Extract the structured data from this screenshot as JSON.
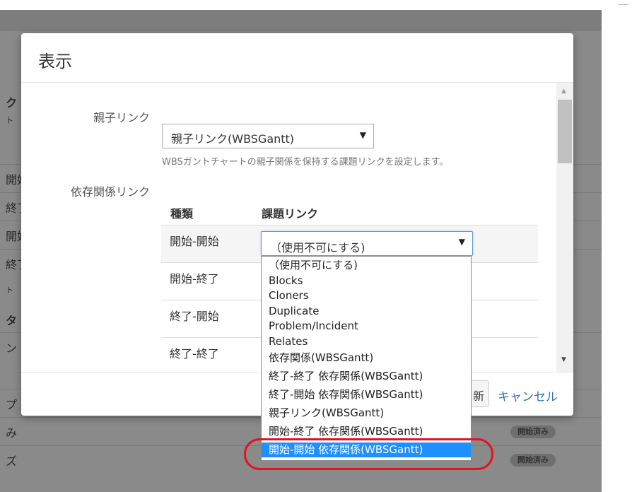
{
  "background": {
    "fragments": [
      "ク",
      "ト",
      "開始",
      "終了",
      "開始",
      "終了",
      "ト",
      "タ",
      "ン",
      "プ",
      "み",
      "ズ"
    ],
    "badges": [
      "開始済み",
      "開始済み"
    ]
  },
  "modal": {
    "title": "表示",
    "parent_link": {
      "label": "親子リンク",
      "value": "親子リンク(WBSGantt)",
      "help": "WBSガントチャートの親子関係を保持する課題リンクを設定します。"
    },
    "dependency": {
      "label": "依存関係リンク",
      "col_type": "種類",
      "col_link": "課題リンク",
      "rows": [
        "開始-開始",
        "開始-終了",
        "終了-開始",
        "終了-終了"
      ]
    },
    "footer": {
      "partial_button": "新",
      "cancel": "キャンセル"
    }
  },
  "dropdown": {
    "current": "（使用不可にする)",
    "options": [
      "（使用不可にする)",
      "Blocks",
      "Cloners",
      "Duplicate",
      "Problem/Incident",
      "Relates",
      "依存関係(WBSGantt)",
      "終了-終了 依存関係(WBSGantt)",
      "終了-開始 依存関係(WBSGantt)",
      "親子リンク(WBSGantt)",
      "開始-終了 依存関係(WBSGantt)",
      "開始-開始 依存関係(WBSGantt)"
    ],
    "selected_index": 11
  },
  "colors": {
    "accent": "#1e90ff",
    "link": "#3572b0",
    "highlight": "#e0141e"
  }
}
